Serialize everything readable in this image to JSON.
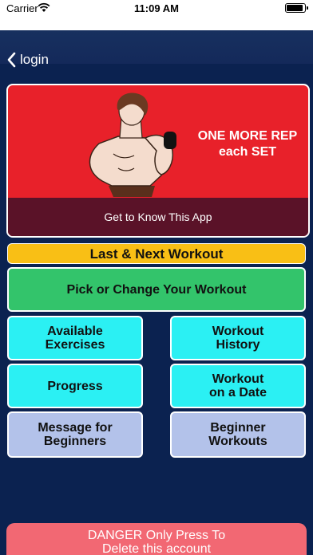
{
  "status_bar": {
    "carrier": "Carrier",
    "time": "11:09 AM"
  },
  "nav": {
    "back_label": "login"
  },
  "hero": {
    "tagline_line1": "ONE MORE REP",
    "tagline_line2": "each SET",
    "strip_label": "Get to Know This App"
  },
  "buttons": {
    "last_next": "Last & Next Workout",
    "pick_change": "Pick or Change Your Workout",
    "available_1": "Available",
    "available_2": "Exercises",
    "history_1": "Workout",
    "history_2": "History",
    "progress": "Progress",
    "on_date_1": "Workout",
    "on_date_2": "on a Date",
    "message_1": "Message for",
    "message_2": "Beginners",
    "beginner_1": "Beginner",
    "beginner_2": "Workouts"
  },
  "danger": {
    "line1": "DANGER Only Press To",
    "line2": "Delete this account"
  },
  "colors": {
    "background": "#0b2250",
    "hero_red": "#e8212a",
    "strip": "#5a1228",
    "yellow": "#f9bf15",
    "green": "#33c46b",
    "cyan": "#2bf0f3",
    "lavender": "#b3c2ea",
    "danger": "#f26873"
  }
}
